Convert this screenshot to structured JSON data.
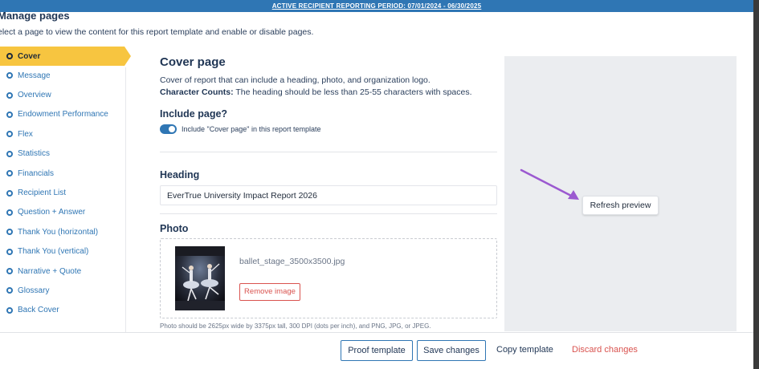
{
  "banner": {
    "text": "ACTIVE RECIPIENT REPORTING PERIOD: 07/01/2024 - 06/30/2025"
  },
  "manage": {
    "title": "Manage pages",
    "subtitle": "elect a page to view the content for this report template and enable or disable pages."
  },
  "sidebar": {
    "items": [
      {
        "label": "Cover",
        "active": true
      },
      {
        "label": "Message"
      },
      {
        "label": "Overview"
      },
      {
        "label": "Endowment Performance"
      },
      {
        "label": "Flex"
      },
      {
        "label": "Statistics"
      },
      {
        "label": "Financials"
      },
      {
        "label": "Recipient List"
      },
      {
        "label": "Question + Answer"
      },
      {
        "label": "Thank You (horizontal)"
      },
      {
        "label": "Thank You (vertical)"
      },
      {
        "label": "Narrative + Quote"
      },
      {
        "label": "Glossary"
      },
      {
        "label": "Back Cover"
      }
    ]
  },
  "cover": {
    "title": "Cover page",
    "description": "Cover of report that can include a heading, photo, and organization logo.",
    "char_counts_label": "Character Counts:",
    "char_counts_text": " The heading should be less than 25-55 characters with spaces.",
    "include_label": "Include page?",
    "include_toggle_on": true,
    "include_text": "Include \"Cover page\" in this report template",
    "heading_label": "Heading",
    "heading_value": "EverTrue University Impact Report 2026",
    "photo_label": "Photo",
    "photo_filename": "ballet_stage_3500x3500.jpg",
    "remove_label": "Remove image",
    "photo_note": "Photo should be 2625px wide by 3375px tall, 300 DPI (dots per inch), and PNG, JPG, or JPEG."
  },
  "preview": {
    "refresh_label": "Refresh preview",
    "annotation_color": "#9b59d0"
  },
  "footer": {
    "proof_label": "Proof template",
    "save_label": "Save changes",
    "copy_label": "Copy template",
    "discard_label": "Discard changes"
  },
  "colors": {
    "accent": "#2f76b4",
    "active_nav": "#f7c540",
    "danger": "#d9534f"
  }
}
